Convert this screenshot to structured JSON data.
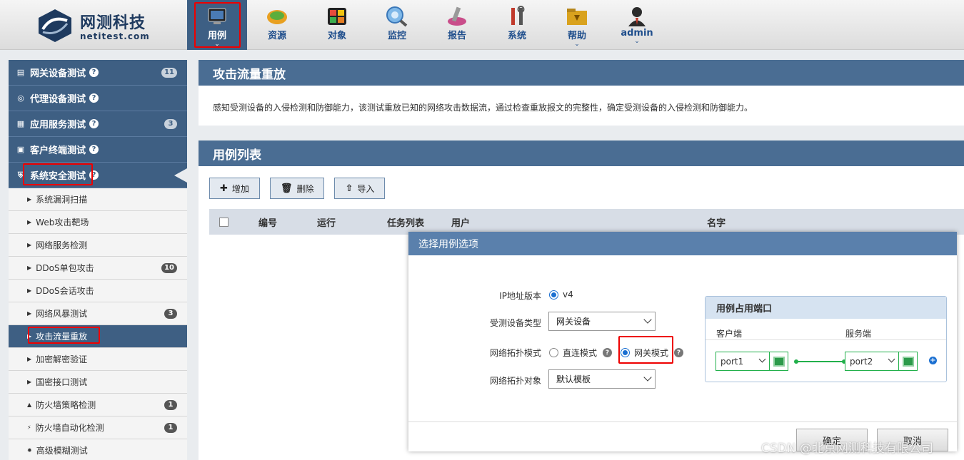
{
  "brand": {
    "title": "网测科技",
    "subtitle": "netitest.com"
  },
  "nav": [
    {
      "label": "用例",
      "icon": "testcase-icon",
      "active": true,
      "caret": true
    },
    {
      "label": "资源",
      "icon": "resource-icon"
    },
    {
      "label": "对象",
      "icon": "object-icon"
    },
    {
      "label": "监控",
      "icon": "monitor-icon"
    },
    {
      "label": "报告",
      "icon": "report-icon"
    },
    {
      "label": "系统",
      "icon": "tools-icon"
    },
    {
      "label": "帮助",
      "icon": "folder-icon",
      "caret": true
    },
    {
      "label": "admin",
      "icon": "user-icon",
      "caret": true
    }
  ],
  "sidebar": {
    "categories": [
      {
        "label": "网关设备测试",
        "badge": "11"
      },
      {
        "label": "代理设备测试",
        "badge": ""
      },
      {
        "label": "应用服务测试",
        "badge": "3"
      },
      {
        "label": "客户终端测试",
        "badge": ""
      },
      {
        "label": "系统安全测试",
        "badge": ""
      }
    ],
    "subitems": [
      {
        "label": "系统漏洞扫描",
        "badge": ""
      },
      {
        "label": "Web攻击靶场",
        "badge": ""
      },
      {
        "label": "网络服务检测",
        "badge": ""
      },
      {
        "label": "DDoS单包攻击",
        "badge": "10"
      },
      {
        "label": "DDoS会话攻击",
        "badge": ""
      },
      {
        "label": "网络风暴测试",
        "badge": "3"
      },
      {
        "label": "攻击流量重放",
        "badge": ""
      },
      {
        "label": "加密解密验证",
        "badge": ""
      },
      {
        "label": "国密接口测试",
        "badge": ""
      },
      {
        "label": "防火墙策略检测",
        "badge": "1"
      },
      {
        "label": "防火墙自动化检测",
        "badge": "1"
      },
      {
        "label": "高级模糊测试",
        "badge": ""
      }
    ]
  },
  "main": {
    "title": "攻击流量重放",
    "description": "感知受测设备的入侵检测和防御能力，该测试重放已知的网络攻击数据流，通过检查重放报文的完整性，确定受测设备的入侵检测和防御能力。",
    "list_title": "用例列表",
    "buttons": {
      "add": "增加",
      "delete": "删除",
      "import": "导入"
    },
    "columns": [
      "编号",
      "运行",
      "任务列表",
      "用户",
      "名字"
    ]
  },
  "modal": {
    "title": "选择用例选项",
    "ip_label": "IP地址版本",
    "ip_value": "v4",
    "device_label": "受测设备类型",
    "device_value": "网关设备",
    "topo_label": "网络拓扑模式",
    "topo_direct": "直连模式",
    "topo_gateway": "网关模式",
    "target_label": "网络拓扑对象",
    "target_value": "默认模板",
    "ports_title": "用例占用端口",
    "client_label": "客户端",
    "server_label": "服务端",
    "client_port": "port1",
    "server_port": "port2",
    "ok": "确定",
    "cancel": "取消"
  },
  "watermark": "CSDN @北京网测科技有限公司"
}
